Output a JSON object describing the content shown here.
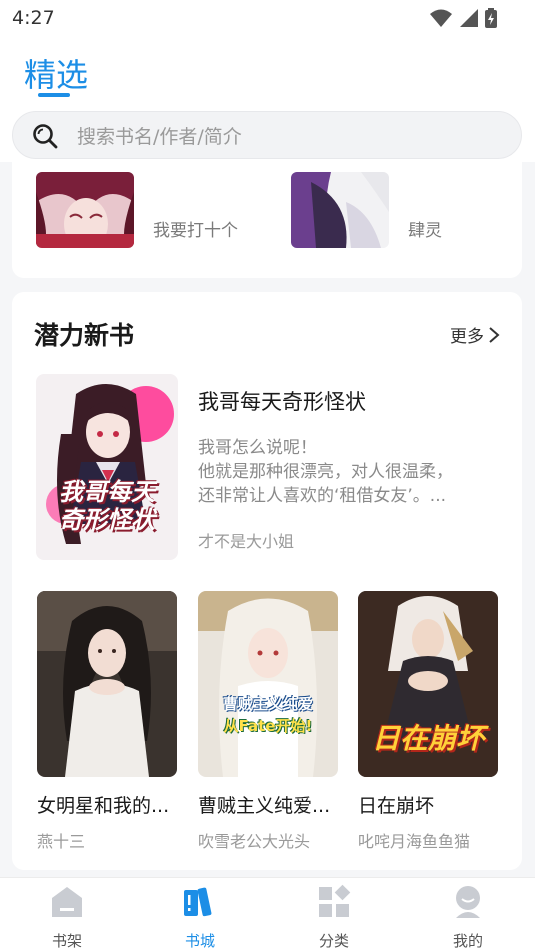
{
  "status_bar": {
    "time": "4:27"
  },
  "header": {
    "tab_title": "精选"
  },
  "search": {
    "placeholder": "搜索书名/作者/简介"
  },
  "top_section": {
    "books": [
      {
        "author": "我要打十个"
      },
      {
        "author": "肆灵"
      }
    ]
  },
  "potential_section": {
    "title": "潜力新书",
    "more_label": "更多",
    "featured": {
      "title": "我哥每天奇形怪状",
      "desc_lines": [
        "我哥怎么说呢！",
        "他就是那种很漂亮，对人很温柔，",
        "还非常让人喜欢的‘租借女友’。..."
      ],
      "author": "才不是大小姐",
      "cover_text": [
        "我哥每天",
        "奇形怪状"
      ]
    },
    "books": [
      {
        "title": "女明星和我的...",
        "author": "燕十三"
      },
      {
        "title": "曹贼主义纯爱...",
        "author": "吹雪老公大光头",
        "cover_text": [
          "曹贼主义纯爱",
          "从Fate开始!"
        ]
      },
      {
        "title": "日在崩坏",
        "author": "叱咤月海鱼鱼猫",
        "cover_text": "日在崩坏"
      }
    ]
  },
  "bottom_nav": {
    "items": [
      {
        "label": "书架"
      },
      {
        "label": "书城"
      },
      {
        "label": "分类"
      },
      {
        "label": "我的"
      }
    ]
  },
  "colors": {
    "accent": "#1c8ee6",
    "icon_gray": "#c9ccd2"
  }
}
